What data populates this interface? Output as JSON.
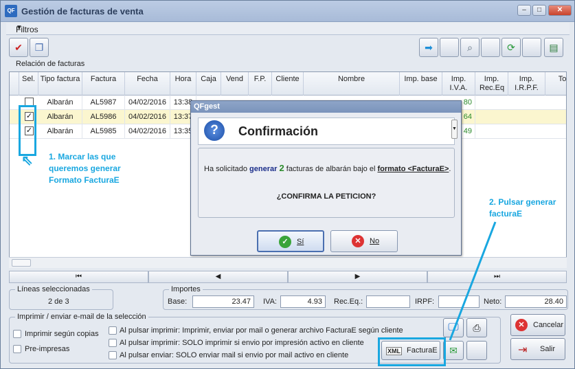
{
  "window": {
    "title": "Gestión de facturas de venta",
    "logo_text": "QF"
  },
  "filters": {
    "label": "Filtros"
  },
  "grid": {
    "caption": "Relación de facturas",
    "columns": [
      "Sel.",
      "Tipo factura",
      "Factura",
      "Fecha",
      "Hora",
      "Caja",
      "Vend",
      "F.P.",
      "Cliente",
      "Nombre",
      "Imp. base",
      "Imp. I.V.A.",
      "Imp. Rec.Eq",
      "Imp. I.R.P.F.",
      "To"
    ],
    "rows": [
      {
        "checked": false,
        "tipo": "Albarán",
        "factura": "AL5987",
        "fecha": "04/02/2016",
        "hora": "13:38",
        "iva": "80"
      },
      {
        "checked": true,
        "tipo": "Albarán",
        "factura": "AL5986",
        "fecha": "04/02/2016",
        "hora": "13:37",
        "iva": "64"
      },
      {
        "checked": true,
        "tipo": "Albarán",
        "factura": "AL5985",
        "fecha": "04/02/2016",
        "hora": "13:35",
        "iva": "49"
      }
    ]
  },
  "lineas": {
    "label": "Líneas seleccionadas",
    "value": "2 de 3"
  },
  "importes": {
    "label": "Importes",
    "base_label": "Base:",
    "base": "23.47",
    "iva_label": "IVA:",
    "iva": "4.93",
    "receq_label": "Rec.Eq.:",
    "receq": "",
    "irpf_label": "IRPF:",
    "irpf": "",
    "neto_label": "Neto:",
    "neto": "28.40"
  },
  "print": {
    "label": "Imprimir / enviar e-mail de la selección",
    "opt1": "Imprimir según copias",
    "opt2": "Pre-impresas",
    "opt3": "Al pulsar imprimir: Imprimir, enviar por mail o generar archivo FacturaE según cliente",
    "opt4": "Al pulsar imprimir: SOLO imprimir si envio por impresión activo en cliente",
    "opt5": "Al pulsar enviar: SOLO enviar mail si envio por mail activo en cliente"
  },
  "buttons": {
    "facturae": "FacturaE",
    "xml": "XML",
    "cancelar": "Cancelar",
    "salir": "Salir"
  },
  "annotations": {
    "step1": "1. Marcar las que queremos generar Formato FacturaE",
    "step2": "2. Pulsar generar facturaE"
  },
  "dialog": {
    "title": "QFgest",
    "heading": "Confirmación",
    "msg_pre": "Ha solicitado ",
    "msg_verb": "generar",
    "msg_count": "2",
    "msg_mid": " facturas de albarán bajo el ",
    "msg_format": "formato <FacturaE>",
    "msg_end": ".",
    "question": "¿CONFIRMA LA PETICION?",
    "yes": "Sí",
    "no": "No"
  },
  "colors": {
    "accent": "#19a7e0",
    "selected_row": "#fbf6cf",
    "green": "#2a8a2a"
  }
}
